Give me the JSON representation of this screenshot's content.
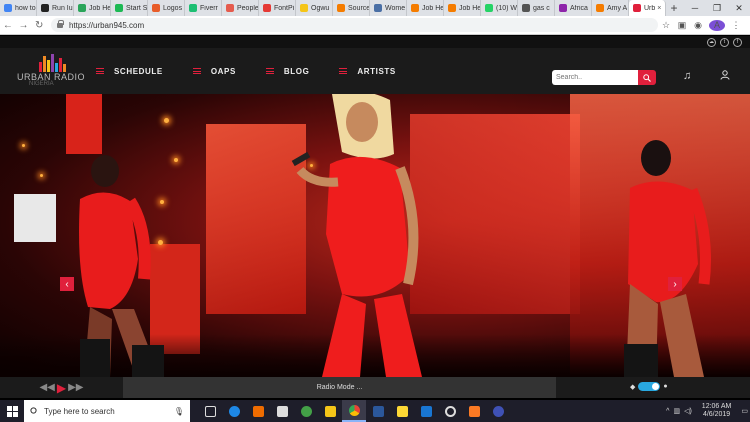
{
  "browser": {
    "tabs": [
      {
        "label": "how to",
        "color": "#4285f4"
      },
      {
        "label": "Run Iu",
        "color": "#222222"
      },
      {
        "label": "Job He",
        "color": "#2aa55a"
      },
      {
        "label": "Start S",
        "color": "#1db954"
      },
      {
        "label": "Logos",
        "color": "#e85d2a"
      },
      {
        "label": "Fiverr",
        "color": "#1dbf73"
      },
      {
        "label": "People",
        "color": "#e55b4d"
      },
      {
        "label": "FontPi",
        "color": "#e53935"
      },
      {
        "label": "Ogwu",
        "color": "#f5c518"
      },
      {
        "label": "Source",
        "color": "#f57c00"
      },
      {
        "label": "Wome",
        "color": "#4a6fa5"
      },
      {
        "label": "Job He",
        "color": "#f57c00"
      },
      {
        "label": "Job He",
        "color": "#f57c00"
      },
      {
        "label": "(10) W",
        "color": "#25d366"
      },
      {
        "label": "gas c",
        "color": "#555555"
      },
      {
        "label": "Africa",
        "color": "#8e24aa"
      },
      {
        "label": "Amy A",
        "color": "#f57c00"
      },
      {
        "label": "Urb",
        "color": "#e0203c",
        "active": true
      }
    ],
    "new_tab": "+",
    "url": "https://urban945.com",
    "avatar_letter": "A"
  },
  "site": {
    "logo_text": "URBAN RADIO",
    "logo_sub": "NIGERIA",
    "nav": [
      {
        "label": "SCHEDULE"
      },
      {
        "label": "OAPS"
      },
      {
        "label": "BLOG"
      },
      {
        "label": "ARTISTS"
      }
    ],
    "search_placeholder": "Search..",
    "accent": "#e0203c"
  },
  "player": {
    "mode_label": "Radio Mode ..."
  },
  "taskbar": {
    "search_placeholder": "Type here to search",
    "time": "12:06 AM",
    "date": "4/6/2019"
  }
}
